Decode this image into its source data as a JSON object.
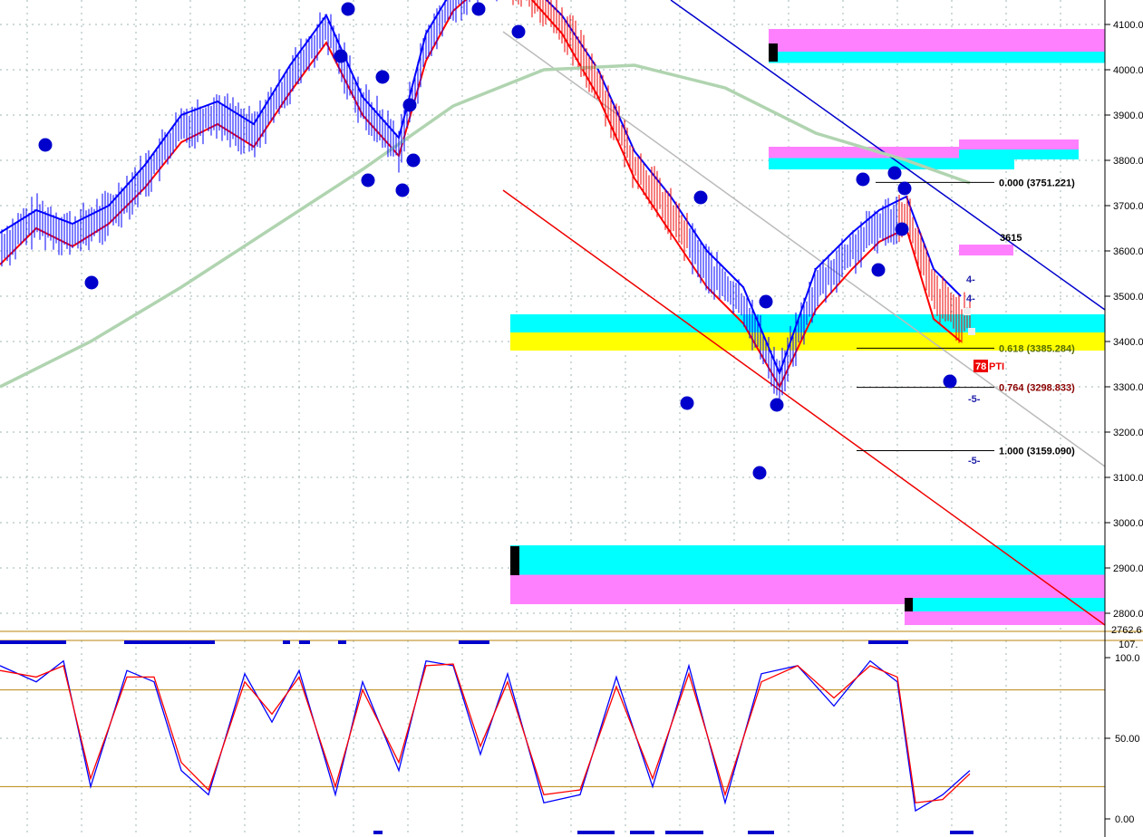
{
  "chart_data": [
    {
      "type": "candlestick",
      "grid": true,
      "y_axis_side": "right",
      "ylim": [
        2762,
        4150
      ],
      "y_ticks": [
        "4100.0",
        "4000.0",
        "3900.0",
        "3800.0",
        "3700.0",
        "3600.0",
        "3500.0",
        "3400.0",
        "3300.0",
        "3200.0",
        "3100.0",
        "3000.0",
        "2900.0",
        "2800.0"
      ],
      "y_ticks_values": [
        4100,
        4000,
        3900,
        3800,
        3700,
        3600,
        3500,
        3400,
        3300,
        3200,
        3100,
        3000,
        2900,
        2800
      ],
      "last_price_label": "2762.6",
      "fib_levels": [
        {
          "label": "0.000 (3751.221)",
          "value": 3751.221,
          "color": "#000000"
        },
        {
          "label": "0.618 (3385.284)",
          "value": 3385.284,
          "color": "#556b00"
        },
        {
          "label": "0.764 (3298.833)",
          "value": 3298.833,
          "color": "#8b0000"
        },
        {
          "label": "1.000 (3159.090)",
          "value": 3159.09,
          "color": "#000000"
        }
      ],
      "annotations": [
        "3615",
        "4-",
        "4-",
        "-5-",
        "-5-",
        "78",
        "PTI"
      ],
      "zones": [
        {
          "color": "#ff80ff",
          "from": 4040,
          "to": 4090
        },
        {
          "color": "#00ffff",
          "from": 4015,
          "to": 4040
        },
        {
          "color": "#ff80ff",
          "from": 3805,
          "to": 3830
        },
        {
          "color": "#00ffff",
          "from": 3780,
          "to": 3805
        },
        {
          "color": "#00ffff",
          "from": 3420,
          "to": 3460
        },
        {
          "color": "#ffff00",
          "from": 3380,
          "to": 3420
        },
        {
          "color": "#00ffff",
          "from": 2885,
          "to": 2950
        },
        {
          "color": "#ff80ff",
          "from": 2820,
          "to": 2885
        }
      ],
      "series": [
        {
          "name": "",
          "color": "#0000ff",
          "x": [
            0,
            40,
            80,
            120,
            160,
            200,
            240,
            280,
            320,
            360,
            400,
            440,
            470,
            500,
            540,
            580,
            620,
            660,
            700,
            740,
            780,
            820,
            860,
            900,
            940,
            970,
            1000,
            1030,
            1060
          ],
          "values": [
            3640,
            3690,
            3660,
            3700,
            3790,
            3900,
            3930,
            3880,
            4010,
            4120,
            3940,
            3850,
            4080,
            4180,
            4230,
            4200,
            4120,
            4000,
            3820,
            3720,
            3600,
            3520,
            3330,
            3560,
            3640,
            3690,
            3720,
            3560,
            3500
          ]
        },
        {
          "name": "",
          "color": "#ff0000",
          "x": [
            0,
            40,
            80,
            120,
            160,
            200,
            240,
            280,
            320,
            360,
            400,
            440,
            470,
            500,
            540,
            580,
            620,
            660,
            700,
            740,
            780,
            820,
            860,
            900,
            940,
            970,
            1000,
            1030,
            1060
          ],
          "values": [
            3570,
            3650,
            3610,
            3660,
            3740,
            3840,
            3880,
            3830,
            3950,
            4060,
            3900,
            3810,
            4020,
            4130,
            4200,
            4170,
            4080,
            3940,
            3760,
            3640,
            3520,
            3440,
            3300,
            3470,
            3560,
            3620,
            3650,
            3450,
            3400
          ]
        },
        {
          "name": "",
          "color": "#b0d4b0",
          "x": [
            0,
            100,
            200,
            300,
            400,
            500,
            600,
            700,
            800,
            900,
            1000,
            1070
          ],
          "values": [
            3300,
            3400,
            3520,
            3650,
            3780,
            3920,
            4000,
            4010,
            3960,
            3860,
            3800,
            3750
          ]
        }
      ]
    },
    {
      "type": "line",
      "title": "",
      "grid": true,
      "ylim": [
        0,
        107
      ],
      "y_ticks": [
        "100.0",
        "50.00",
        "0.00"
      ],
      "y_ticks_values": [
        100,
        50,
        0
      ],
      "top_label": "107.",
      "reference_lines": [
        80,
        20
      ],
      "series": [
        {
          "name": "",
          "color": "#0000ff",
          "x": [
            0,
            40,
            70,
            100,
            140,
            170,
            200,
            230,
            270,
            300,
            330,
            370,
            400,
            440,
            470,
            500,
            530,
            560,
            600,
            640,
            680,
            720,
            760,
            800,
            840,
            880,
            920,
            960,
            990,
            1010,
            1040,
            1070
          ],
          "values": [
            95,
            85,
            98,
            20,
            92,
            85,
            30,
            15,
            90,
            60,
            92,
            15,
            85,
            30,
            98,
            95,
            40,
            90,
            10,
            15,
            88,
            20,
            95,
            10,
            90,
            95,
            70,
            98,
            85,
            5,
            15,
            30
          ]
        },
        {
          "name": "",
          "color": "#ff0000",
          "x": [
            0,
            40,
            70,
            100,
            140,
            170,
            200,
            230,
            270,
            300,
            330,
            370,
            400,
            440,
            470,
            500,
            530,
            560,
            600,
            640,
            680,
            720,
            760,
            800,
            840,
            880,
            920,
            960,
            990,
            1010,
            1040,
            1070
          ],
          "values": [
            92,
            88,
            95,
            25,
            88,
            88,
            35,
            18,
            85,
            65,
            88,
            20,
            80,
            35,
            95,
            96,
            45,
            85,
            15,
            18,
            82,
            25,
            90,
            15,
            85,
            95,
            75,
            95,
            88,
            10,
            12,
            28
          ]
        }
      ]
    }
  ]
}
